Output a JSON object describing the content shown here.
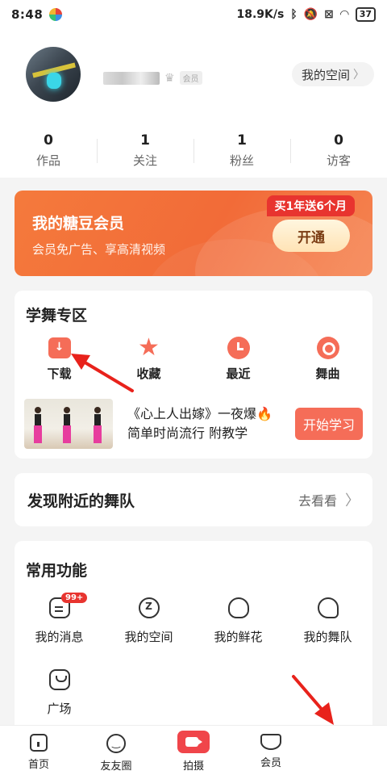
{
  "status_bar": {
    "time": "8:48",
    "speed": "18.9K/s",
    "battery": "37"
  },
  "profile": {
    "vip_badge": "会员",
    "my_space_label": "我的空间",
    "stats": [
      {
        "value": "0",
        "label": "作品"
      },
      {
        "value": "1",
        "label": "关注"
      },
      {
        "value": "1",
        "label": "粉丝"
      },
      {
        "value": "0",
        "label": "访客"
      }
    ]
  },
  "vip_banner": {
    "title": "我的糖豆会员",
    "subtitle": "会员免广告、享高清视频",
    "tag": "买1年送6个月",
    "button": "开通"
  },
  "learn": {
    "title": "学舞专区",
    "items": [
      {
        "label": "下载",
        "icon": "download-icon"
      },
      {
        "label": "收藏",
        "icon": "star-icon"
      },
      {
        "label": "最近",
        "icon": "clock-icon"
      },
      {
        "label": "舞曲",
        "icon": "music-disc-icon"
      }
    ],
    "promo": {
      "line1": "《心上人出嫁》一夜爆🔥",
      "line2": "简单时尚流行  附教学",
      "button": "开始学习"
    }
  },
  "nearby": {
    "title": "发现附近的舞队",
    "action": "去看看"
  },
  "common": {
    "title": "常用功能",
    "badge": "99+",
    "items": [
      {
        "label": "我的消息",
        "icon": "message-icon"
      },
      {
        "label": "我的空间",
        "icon": "space-icon"
      },
      {
        "label": "我的鲜花",
        "icon": "flower-icon"
      },
      {
        "label": "我的舞队",
        "icon": "team-icon"
      },
      {
        "label": "广场",
        "icon": "shopping-bag-icon"
      }
    ]
  },
  "tabbar": {
    "items": [
      {
        "label": "首页",
        "icon": "home-icon"
      },
      {
        "label": "友友圈",
        "icon": "smile-icon"
      },
      {
        "label": "拍摄",
        "icon": "video-camera-icon"
      },
      {
        "label": "会员",
        "icon": "vip-diamond-icon"
      }
    ]
  },
  "colors": {
    "accent": "#f56d58",
    "vip_orange": "#f26b38",
    "tag_red": "#e8342f",
    "arrow_red": "#e8221b"
  }
}
